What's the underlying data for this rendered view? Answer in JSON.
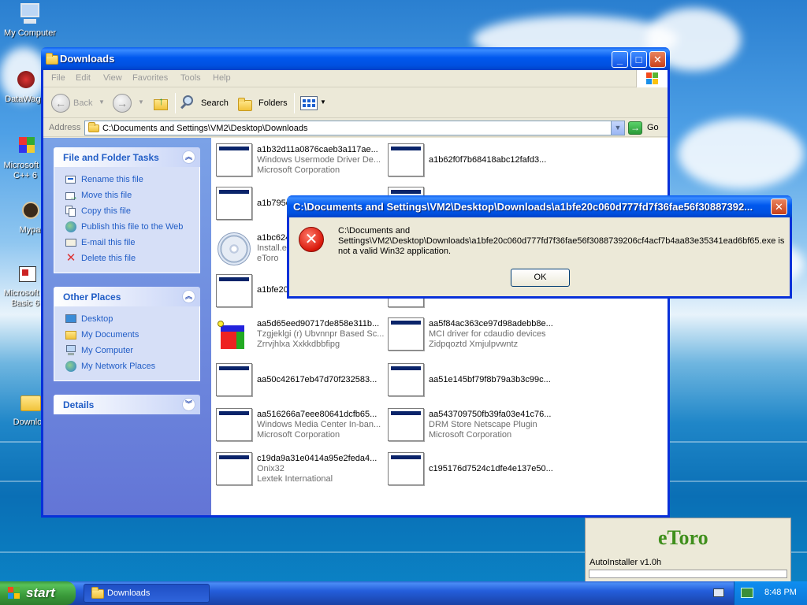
{
  "desktop": {
    "icons": [
      {
        "label": "My Computer"
      },
      {
        "label": "DataWago"
      },
      {
        "label": "Microsoft V C++ 6"
      },
      {
        "label": "Mypa"
      },
      {
        "label": "Microsoft V Basic 6"
      },
      {
        "label": "Downloa"
      }
    ]
  },
  "window": {
    "title": "Downloads",
    "menu": [
      "File",
      "Edit",
      "View",
      "Favorites",
      "Tools",
      "Help"
    ],
    "toolbar": {
      "back": "Back",
      "search": "Search",
      "folders": "Folders"
    },
    "address": {
      "label": "Address",
      "value": "C:\\Documents and Settings\\VM2\\Desktop\\Downloads",
      "go": "Go"
    }
  },
  "tasks": {
    "file_folder": {
      "title": "File and Folder Tasks",
      "items": [
        "Rename this file",
        "Move this file",
        "Copy this file",
        "Publish this file to the Web",
        "E-mail this file",
        "Delete this file"
      ]
    },
    "other_places": {
      "title": "Other Places",
      "items": [
        "Desktop",
        "My Documents",
        "My Computer",
        "My Network Places"
      ]
    },
    "details": {
      "title": "Details"
    }
  },
  "files": [
    {
      "name": "a1b32d11a0876caeb3a117ae...",
      "desc": "Windows Usermode Driver De...",
      "company": "Microsoft Corporation"
    },
    {
      "name": "a1b62f0f7b68418abc12fafd3...",
      "desc": "",
      "company": ""
    },
    {
      "name": "a1b795e",
      "desc": "",
      "company": ""
    },
    {
      "name": "",
      "desc": "",
      "company": ""
    },
    {
      "name": "a1bc624",
      "desc": "Install.ex",
      "company": "eToro"
    },
    {
      "name": "",
      "desc": "",
      "company": ""
    },
    {
      "name": "a1bfe20c",
      "desc": "",
      "company": ""
    },
    {
      "name": "",
      "desc": "",
      "company": ""
    },
    {
      "name": "aa5d65eed90717de858e311b...",
      "desc": "Tzgjeklgi (r) Ubvnnpr Based Sc...",
      "company": "Zrrvjhlxa Xxkkdbbfipg"
    },
    {
      "name": "aa5f84ac363ce97d98adebb8e...",
      "desc": "MCI driver for cdaudio devices",
      "company": "Zidpqoztd Xmjulpvwntz"
    },
    {
      "name": "aa50c42617eb47d70f232583...",
      "desc": "",
      "company": ""
    },
    {
      "name": "aa51e145bf79f8b79a3b3c99c...",
      "desc": "",
      "company": ""
    },
    {
      "name": "aa516266a7eee80641dcfb65...",
      "desc": "Windows Media Center In-ban...",
      "company": "Microsoft Corporation"
    },
    {
      "name": "aa543709750fb39fa03e41c76...",
      "desc": "DRM Store Netscape Plugin",
      "company": "Microsoft Corporation"
    },
    {
      "name": "c19da9a31e0414a95e2feda4...",
      "desc": "Onix32",
      "company": "Lextek International"
    },
    {
      "name": "c195176d7524c1dfe4e137e50...",
      "desc": "",
      "company": ""
    }
  ],
  "dialog": {
    "title": "C:\\Documents and Settings\\VM2\\Desktop\\Downloads\\a1bfe20c060d777fd7f36fae56f30887392...",
    "message_line1": "C:\\Documents and",
    "message_line2": "Settings\\VM2\\Desktop\\Downloads\\a1bfe20c060d777fd7f36fae56f3088739206cf4acf7b4aa83e35341ead6bf65.exe is",
    "message_line3": "not a valid Win32 application.",
    "ok": "OK"
  },
  "installer": {
    "logo": "eToro",
    "label": "AutoInstaller v1.0h"
  },
  "taskbar": {
    "start": "start",
    "task": "Downloads",
    "clock": "8:48 PM"
  },
  "colors": {
    "xp_blue": "#0831d9",
    "link_blue": "#215dc6",
    "error_red": "#d8180a"
  }
}
